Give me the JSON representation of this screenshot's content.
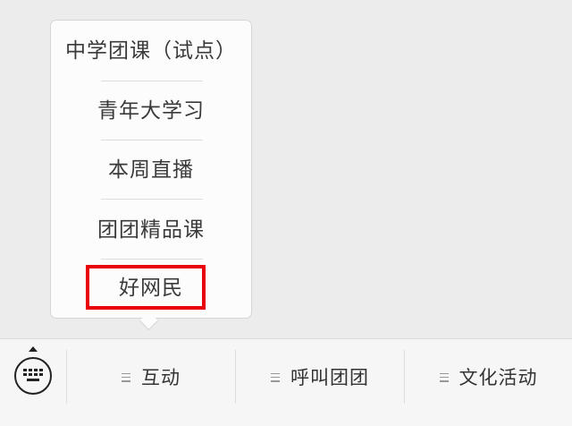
{
  "popup_menu": {
    "items": [
      {
        "label": "中学团课（试点）"
      },
      {
        "label": "青年大学习"
      },
      {
        "label": "本周直播"
      },
      {
        "label": "团团精品课"
      },
      {
        "label": "好网民"
      }
    ]
  },
  "bottom_bar": {
    "keyboard_icon": "keyboard-icon",
    "tabs": [
      {
        "label": "互动",
        "icon": "menu-lines-icon"
      },
      {
        "label": "呼叫团团",
        "icon": "menu-lines-icon"
      },
      {
        "label": "文化活动",
        "icon": "menu-lines-icon"
      }
    ]
  },
  "colors": {
    "highlight_border": "#e8000b",
    "background": "#ececec",
    "popup_background": "#fcfcfc"
  }
}
